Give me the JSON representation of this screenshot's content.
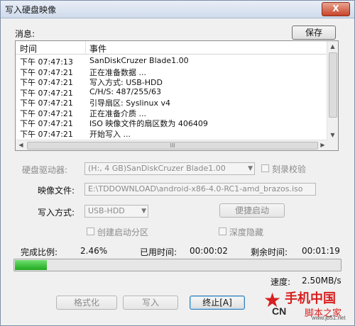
{
  "window": {
    "title": "写入硬盘映像",
    "close_glyph": "X"
  },
  "messages": {
    "label": "消息:",
    "save_button": "保存",
    "columns": {
      "time": "时间",
      "event": "事件"
    },
    "rows": [
      {
        "time": "下午 07:47:13",
        "event": "SanDiskCruzer Blade1.00"
      },
      {
        "time": "下午 07:47:21",
        "event": "正在准备数据 ..."
      },
      {
        "time": "下午 07:47:21",
        "event": "写入方式: USB-HDD"
      },
      {
        "time": "下午 07:47:21",
        "event": "C/H/S: 487/255/63"
      },
      {
        "time": "下午 07:47:21",
        "event": "引导扇区: Syslinux v4"
      },
      {
        "time": "下午 07:47:21",
        "event": "正在准备介质 ..."
      },
      {
        "time": "下午 07:47:21",
        "event": "ISO 映像文件的扇区数为 406409"
      },
      {
        "time": "下午 07:47:21",
        "event": "开始写入 ..."
      }
    ],
    "hscroll_grip": "III"
  },
  "form": {
    "drive_label": "硬盘驱动器:",
    "drive_value": "(H:, 4 GB)SanDiskCruzer Blade1.00",
    "verify_label": "刻录校验",
    "image_label": "映像文件:",
    "image_value": "E:\\TDDOWNLOAD\\android-x86-4.0-RC1-amd_brazos.iso",
    "write_mode_label": "写入方式:",
    "write_mode_value": "USB-HDD",
    "quick_boot_button": "便捷启动",
    "create_boot_partition_label": "创建启动分区",
    "deep_hide_label": "深度隐藏"
  },
  "status": {
    "progress_label": "完成比例:",
    "progress_value": "2.46%",
    "progress_fraction": 0.0246,
    "elapsed_label": "已用时间:",
    "elapsed_value": "00:00:02",
    "remaining_label": "剩余时间:",
    "remaining_value": "00:01:19",
    "speed_label": "速度:",
    "speed_value": "2.50MB/s"
  },
  "buttons": {
    "format": "格式化",
    "write": "写入",
    "abort": "终止[A]"
  },
  "watermark": {
    "brand": "手机中国",
    "cn": "CN",
    "site": "脚本之家",
    "url": "www.jb51.net"
  },
  "colors": {
    "progress_fill": "#1fa81f",
    "close_button": "#c7442a",
    "watermark_red": "#d81e1e"
  }
}
